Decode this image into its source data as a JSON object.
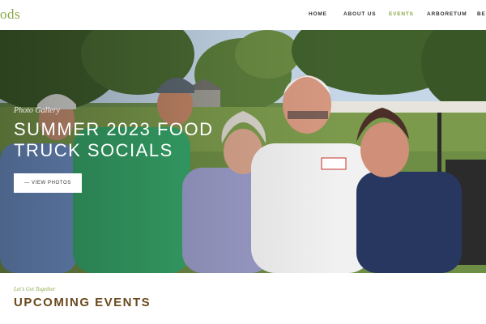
{
  "header": {
    "logo_text": "ods",
    "nav": [
      {
        "label": "HOME",
        "active": false
      },
      {
        "label": "ABOUT US",
        "active": false
      },
      {
        "label": "EVENTS",
        "active": true
      },
      {
        "label": "ARBORETUM",
        "active": false
      },
      {
        "label": "BE",
        "active": false
      }
    ]
  },
  "hero": {
    "kicker": "Photo Gallery",
    "title_line1": "SUMMER 2023 FOOD",
    "title_line2": "TRUCK SOCIALS",
    "button_label": "— VIEW PHOTOS",
    "shirt_patch_text": "Boyd's"
  },
  "events": {
    "kicker": "Let's Get Together",
    "title": "UPCOMING EVENTS"
  },
  "colors": {
    "accent": "#8aa848",
    "heading_brown": "#6b4a1e",
    "nav_text": "#333333"
  }
}
